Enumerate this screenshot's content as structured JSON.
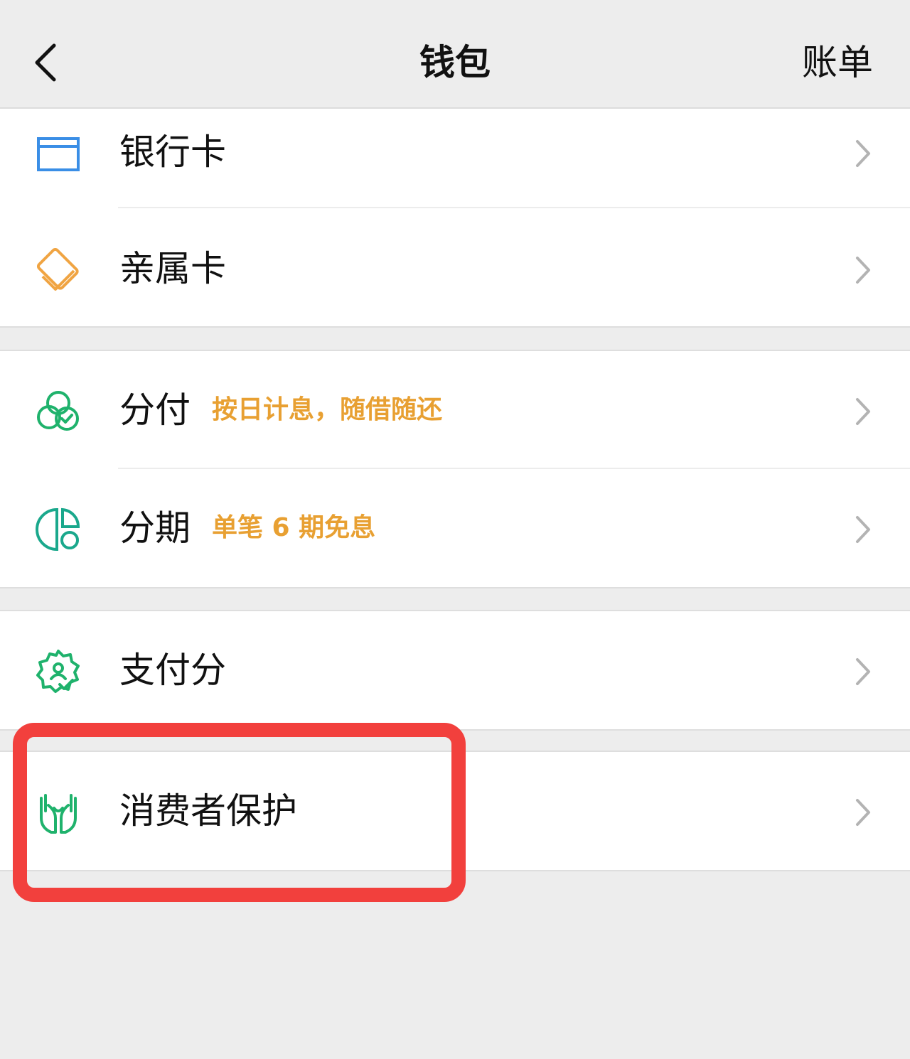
{
  "header": {
    "back_icon": "chevron-left-icon",
    "title": "钱包",
    "bill_label": "账单"
  },
  "groups": [
    {
      "items": [
        {
          "label": "银行卡",
          "icon": "bank-card-icon",
          "icon_color": "#3a8ee6"
        },
        {
          "label": "亲属卡",
          "icon": "family-card-icon",
          "icon_color": "#f0a442"
        }
      ]
    },
    {
      "items": [
        {
          "label": "分付",
          "promo": "按日计息，随借随还",
          "icon": "fenfu-icon",
          "icon_color": "#1fb26c"
        },
        {
          "label": "分期",
          "promo": "单笔 6 期免息",
          "icon": "installment-icon",
          "icon_color": "#1aa88c"
        }
      ]
    },
    {
      "items": [
        {
          "label": "支付分",
          "icon": "pay-score-badge-icon",
          "icon_color": "#1fb26c"
        }
      ]
    },
    {
      "items": [
        {
          "label": "消费者保护",
          "icon": "consumer-protection-hands-icon",
          "icon_color": "#1fb26c",
          "highlighted": true
        }
      ]
    }
  ],
  "colors": {
    "background": "#ededed",
    "card": "#ffffff",
    "promo_text": "#e8a032",
    "highlight_annotation": "#f2403d",
    "chevron": "#b3b3b3"
  }
}
